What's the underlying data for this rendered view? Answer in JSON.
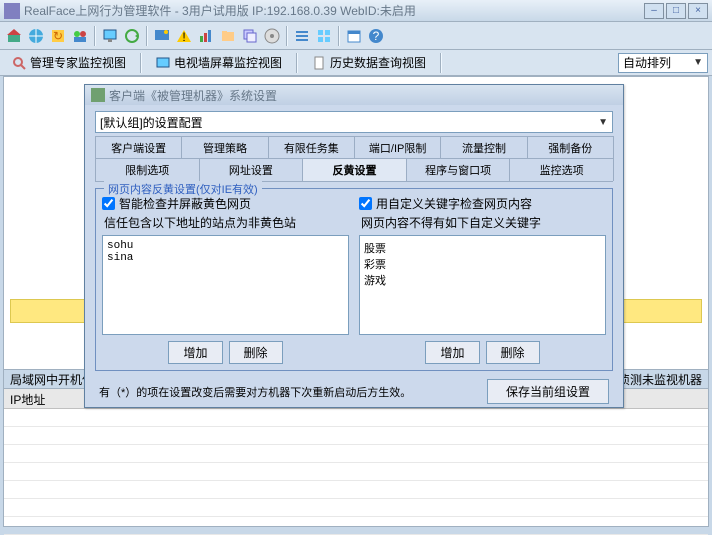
{
  "titlebar": {
    "text": "RealFace上网行为管理软件 - 3用户试用版 IP:192.168.0.39 WebID:未启用"
  },
  "tabs": {
    "t1": "管理专家监控视图",
    "t2": "电视墙屏幕监控视图",
    "t3": "历史数据查询视图",
    "sort": "自动排列"
  },
  "status": {
    "left": "局域网中开机但是",
    "right": "不侦测未监视机器"
  },
  "grid": {
    "col1": "IP地址"
  },
  "dialog": {
    "title": "客户端《被管理机器》系统设置",
    "group": "[默认组]的设置配置",
    "tabsRow1": [
      "客户端设置",
      "管理策略",
      "有限任务集",
      "端口/IP限制",
      "流量控制",
      "强制备份"
    ],
    "tabsRow2": [
      "限制选项",
      "网址设置",
      "反黄设置",
      "程序与窗口项",
      "监控选项"
    ],
    "fieldset": "网页内容反黄设置(仅对IE有效)",
    "left": {
      "chk": "智能检查并屏蔽黄色网页",
      "desc": "信任包含以下地址的站点为非黄色站",
      "items": "sohu\nsina"
    },
    "right": {
      "chk": "用自定义关键字检查网页内容",
      "desc": "网页内容不得有如下自定义关键字",
      "items": "股票\n彩票\n游戏"
    },
    "buttons": {
      "add": "增加",
      "del": "删除"
    },
    "footer": "有（*）的项在设置改变后需要对方机器下次重新启动后方生效。",
    "save": "保存当前组设置"
  }
}
